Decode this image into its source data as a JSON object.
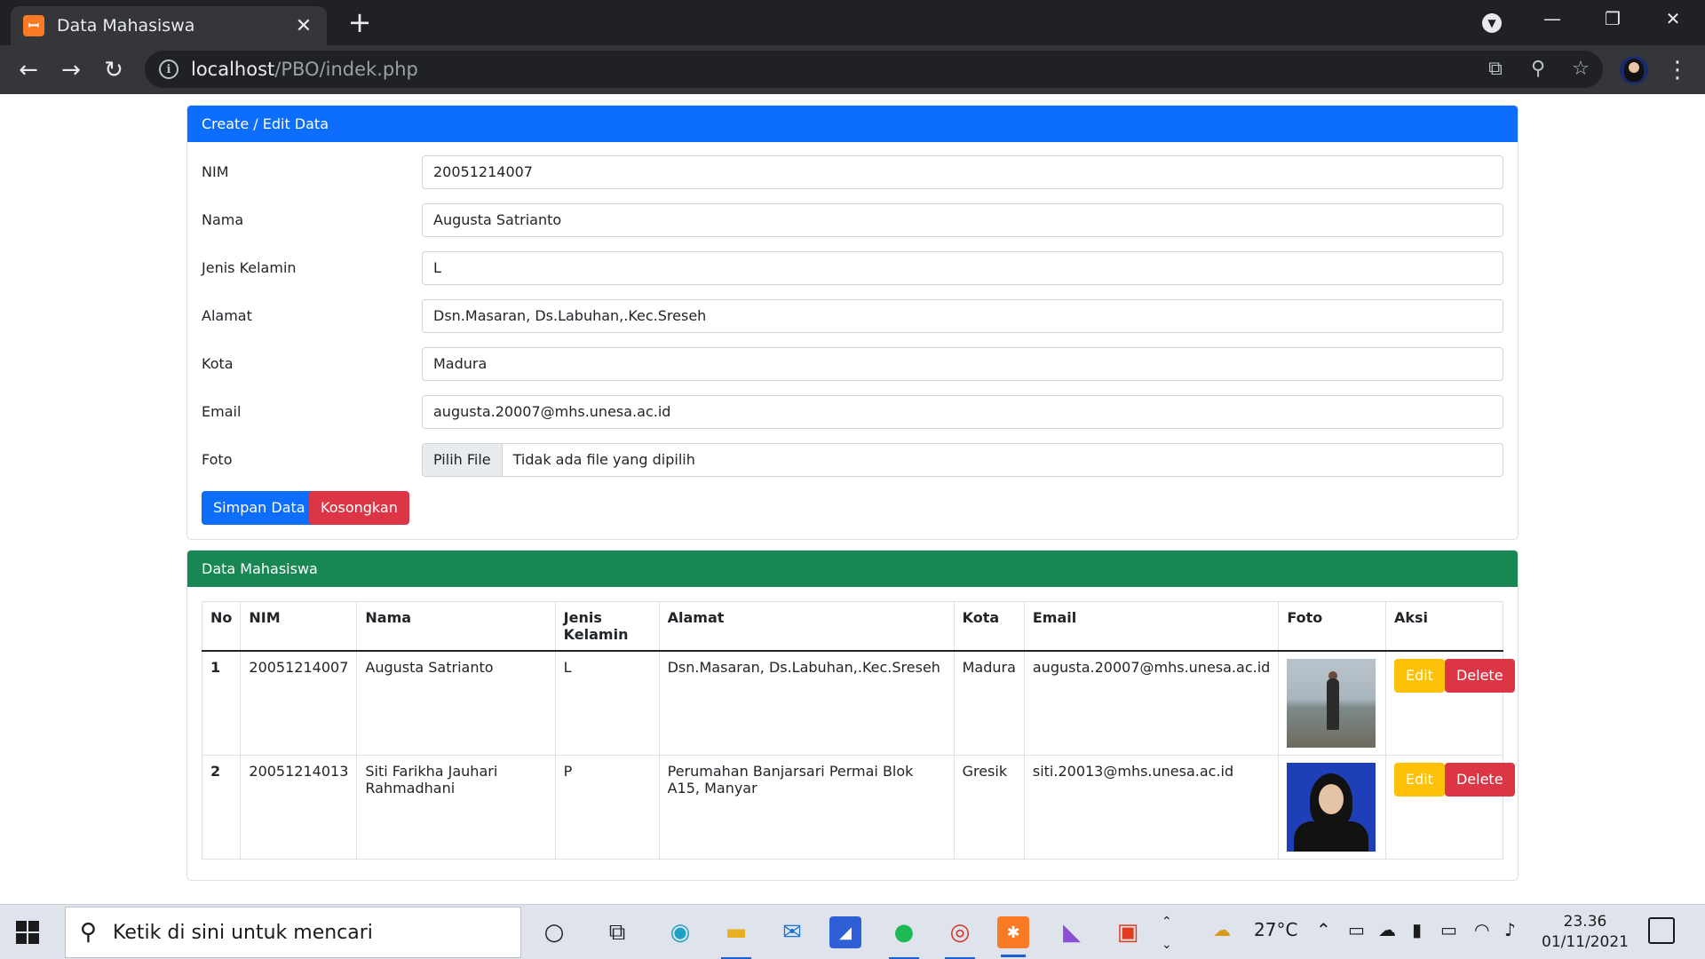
{
  "browser": {
    "tab_title": "Data Mahasiswa",
    "tab_close": "✕",
    "new_tab": "+",
    "url_host": "localhost",
    "url_path": "/PBO/indek.php",
    "window_controls": {
      "minimize": "—",
      "restore": "❐",
      "close": "✕"
    }
  },
  "form_card": {
    "title": "Create / Edit Data",
    "fields": [
      {
        "label": "NIM",
        "value": "20051214007"
      },
      {
        "label": "Nama",
        "value": "Augusta Satrianto"
      },
      {
        "label": "Jenis Kelamin",
        "value": "L"
      },
      {
        "label": "Alamat",
        "value": "Dsn.Masaran, Ds.Labuhan,.Kec.Sreseh"
      },
      {
        "label": "Kota",
        "value": "Madura"
      },
      {
        "label": "Email",
        "value": "augusta.20007@mhs.unesa.ac.id"
      },
      {
        "label": "Foto",
        "file_button": "Pilih File",
        "file_status": "Tidak ada file yang dipilih"
      }
    ],
    "save_label": "Simpan Data",
    "clear_label": "Kosongkan"
  },
  "table_card": {
    "title": "Data Mahasiswa",
    "headers": [
      "No",
      "NIM",
      "Nama",
      "Jenis Kelamin",
      "Alamat",
      "Kota",
      "Email",
      "Foto",
      "Aksi"
    ],
    "rows": [
      {
        "no": "1",
        "nim": "20051214007",
        "nama": "Augusta Satrianto",
        "jk": "L",
        "alamat": "Dsn.Masaran, Ds.Labuhan,.Kec.Sreseh",
        "kota": "Madura",
        "email": "augusta.20007@mhs.unesa.ac.id",
        "edit": "Edit",
        "delete": "Delete"
      },
      {
        "no": "2",
        "nim": "20051214013",
        "nama": "Siti Farikha Jauhari Rahmadhani",
        "jk": "P",
        "alamat": "Perumahan Banjarsari Permai Blok A15, Manyar",
        "kota": "Gresik",
        "email": "siti.20013@mhs.unesa.ac.id",
        "edit": "Edit",
        "delete": "Delete"
      }
    ]
  },
  "taskbar": {
    "search_placeholder": "Ketik di sini untuk mencari",
    "weather": "27°C",
    "time": "23.36",
    "date": "01/11/2021"
  },
  "colors": {
    "primary": "#0d6efd",
    "success": "#198754",
    "danger": "#dc3545",
    "warning": "#ffc107"
  }
}
